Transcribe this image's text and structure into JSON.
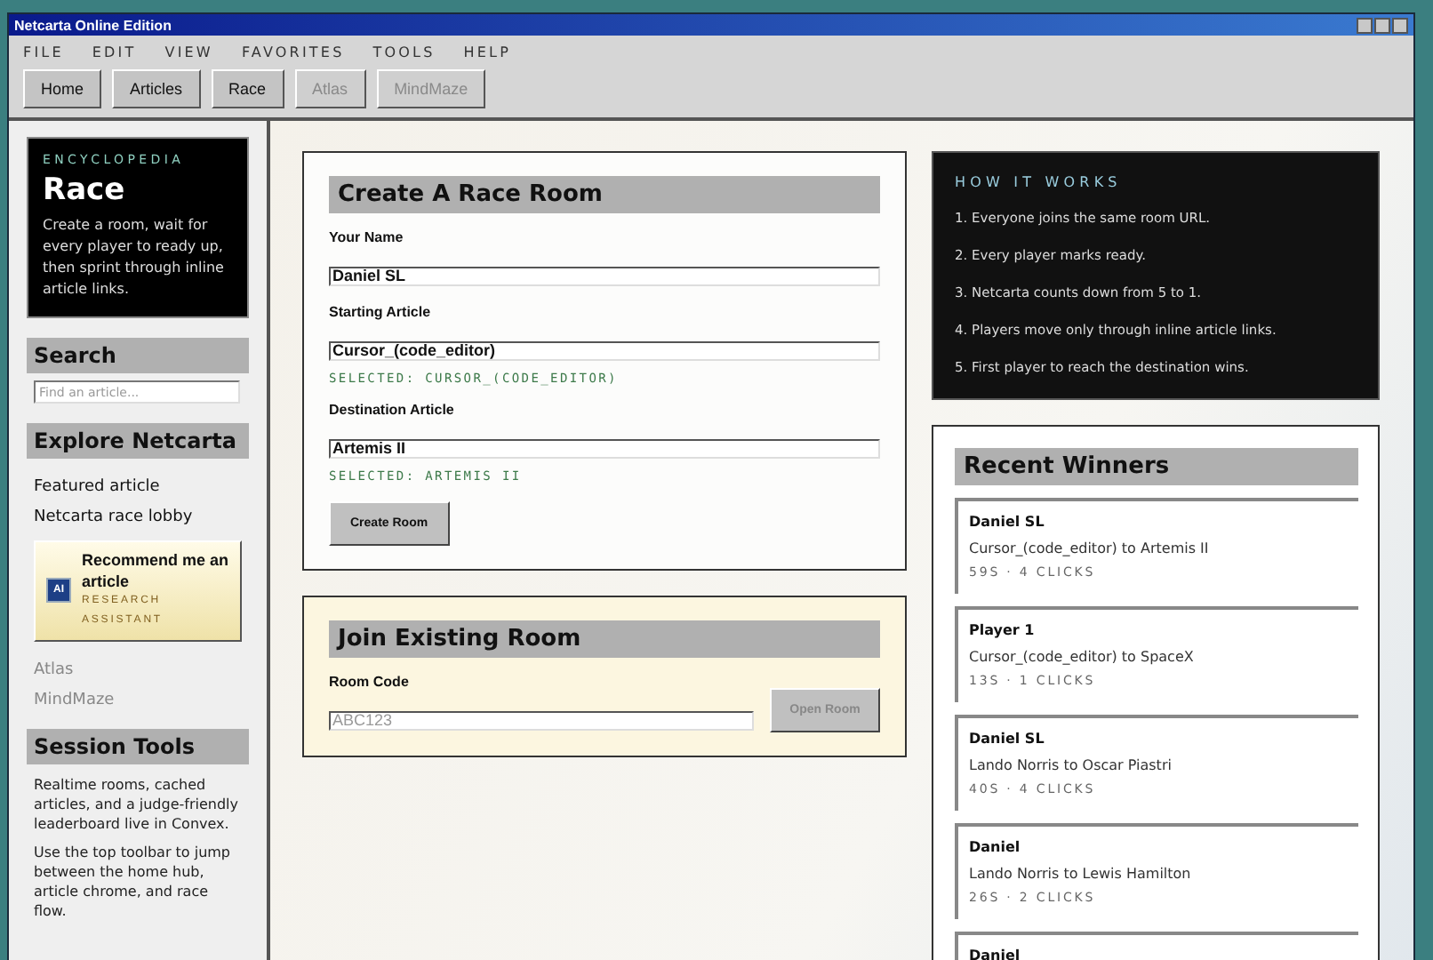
{
  "window": {
    "title": "Netcarta Online Edition"
  },
  "menu": [
    "FILE",
    "EDIT",
    "VIEW",
    "FAVORITES",
    "TOOLS",
    "HELP"
  ],
  "toolbar": [
    {
      "label": "Home",
      "disabled": false
    },
    {
      "label": "Articles",
      "disabled": false
    },
    {
      "label": "Race",
      "disabled": false
    },
    {
      "label": "Atlas",
      "disabled": true
    },
    {
      "label": "MindMaze",
      "disabled": true
    }
  ],
  "sidebar": {
    "hero": {
      "eyebrow": "ENCYCLOPEDIA",
      "title": "Race",
      "text": "Create a room, wait for every player to ready up, then sprint through inline article links."
    },
    "search": {
      "heading": "Search",
      "placeholder": "Find an article..."
    },
    "explore": {
      "heading": "Explore Netcarta",
      "links": [
        {
          "label": "Featured article",
          "disabled": false
        },
        {
          "label": "Netcarta race lobby",
          "disabled": false
        }
      ],
      "assistant": {
        "badge": "AI",
        "title": "Recommend me an article",
        "subtitle": "RESEARCH ASSISTANT"
      },
      "more_links": [
        {
          "label": "Atlas",
          "disabled": true
        },
        {
          "label": "MindMaze",
          "disabled": true
        }
      ]
    },
    "session": {
      "heading": "Session Tools",
      "paragraphs": [
        "Realtime rooms, cached articles, and a judge-friendly leaderboard live in Convex.",
        "Use the top toolbar to jump between the home hub, article chrome, and race flow."
      ]
    }
  },
  "create_room": {
    "heading": "Create A Race Room",
    "fields": [
      {
        "label": "Your Name",
        "value": "Daniel SL"
      },
      {
        "label": "Starting Article",
        "value": "Cursor_(code_editor)",
        "note": "SELECTED: CURSOR_(CODE_EDITOR)"
      },
      {
        "label": "Destination Article",
        "value": "Artemis II",
        "note": "SELECTED: ARTEMIS II"
      }
    ],
    "button": {
      "label": "Create Room",
      "disabled": false
    }
  },
  "join_room": {
    "heading": "Join Existing Room",
    "label": "Room Code",
    "placeholder": "ABC123",
    "button": {
      "label": "Open Room",
      "disabled": true
    }
  },
  "how_it_works": {
    "heading": "HOW IT WORKS",
    "steps": [
      "1. Everyone joins the same room URL.",
      "2. Every player marks ready.",
      "3. Netcarta counts down from 5 to 1.",
      "4. Players move only through inline article links.",
      "5. First player to reach the destination wins."
    ]
  },
  "recent_winners": {
    "heading": "Recent Winners",
    "items": [
      {
        "name": "Daniel SL",
        "route": "Cursor_(code_editor) to Artemis II",
        "stats": "59S · 4 CLICKS"
      },
      {
        "name": "Player 1",
        "route": "Cursor_(code_editor) to SpaceX",
        "stats": "13S · 1 CLICKS"
      },
      {
        "name": "Daniel SL",
        "route": "Lando Norris to Oscar Piastri",
        "stats": "40S · 4 CLICKS"
      },
      {
        "name": "Daniel",
        "route": "Lando Norris to Lewis Hamilton",
        "stats": "26S · 2 CLICKS"
      },
      {
        "name": "Daniel"
      }
    ]
  }
}
